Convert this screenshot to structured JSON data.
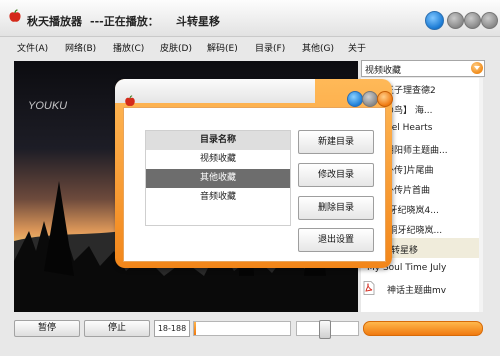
{
  "app": {
    "name": "秋天播放器",
    "now_playing_prefix": "---正在播放：",
    "now_playing_title": "斗转星移"
  },
  "menu": [
    "文件(A)",
    "网络(B)",
    "播放(C)",
    "皮肤(D)",
    "解码(E)",
    "目录(F)",
    "其他(G)",
    "关于"
  ],
  "video": {
    "watermark": "YOUKU"
  },
  "playlist": {
    "selected": "视频收藏",
    "items": [
      "钢琴王子理查德2",
      "片翼の鸟】 海...",
      "Parallel Hearts",
      "平年阴阳师主题曲...",
      "武林外传]片尾曲",
      "武林外传片首曲",
      "]齿铜牙纪晓岚4...",
      "]铁齿铜牙纪晓岚...",
      "转星移",
      "My Soul Time July",
      "神话主题曲mv"
    ],
    "active_index": 8
  },
  "controls": {
    "pause_label": "暂停",
    "stop_label": "停止",
    "time": "18-188",
    "progress_fraction": 0.02,
    "volume_fraction": 0.45
  },
  "dialog": {
    "table_header": "目录名称",
    "rows": [
      "视频收藏",
      "其他收藏",
      "音频收藏"
    ],
    "selected_row": 1,
    "buttons": {
      "new": "新建目录",
      "edit": "修改目录",
      "delete": "删除目录",
      "exit": "退出设置"
    }
  },
  "colors": {
    "accent": "#f0861a",
    "selected_row": "#6d6d6d"
  },
  "icons": [
    "apple-icon",
    "skin-icon",
    "minimize-icon",
    "maximize-icon",
    "close-icon",
    "dropdown-arrow-icon",
    "pdf-file-icon"
  ]
}
